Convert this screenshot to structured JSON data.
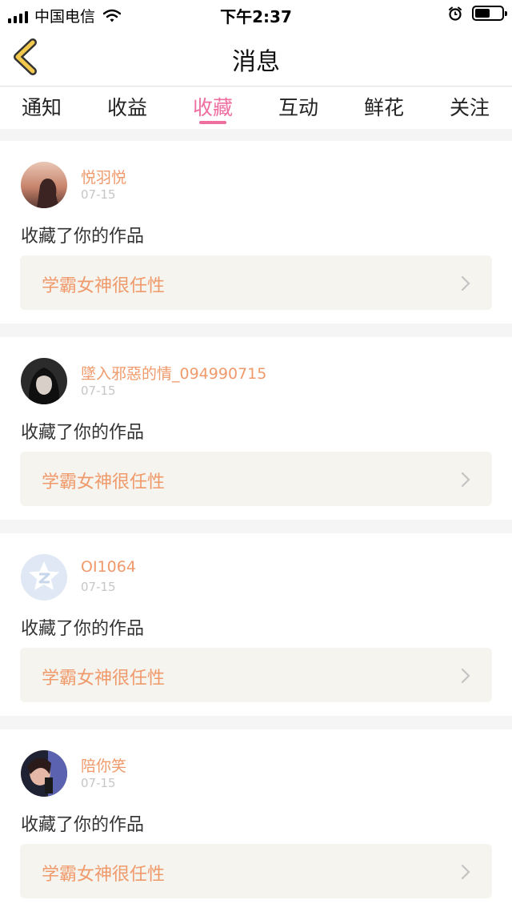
{
  "status_bar": {
    "carrier": "中国电信",
    "time": "下午2:37",
    "battery_level": 0.55,
    "icons": [
      "signal-icon",
      "wifi-icon",
      "alarm-icon",
      "battery-icon"
    ]
  },
  "nav": {
    "title": "消息",
    "back_icon": "chevron-left-icon"
  },
  "tabs": [
    {
      "label": "通知",
      "active": false
    },
    {
      "label": "收益",
      "active": false
    },
    {
      "label": "收藏",
      "active": true
    },
    {
      "label": "互动",
      "active": false
    },
    {
      "label": "鲜花",
      "active": false
    },
    {
      "label": "关注",
      "active": false
    }
  ],
  "messages": [
    {
      "user": "悦羽悦",
      "date": "07-15",
      "action": "收藏了你的作品",
      "work_title": "学霸女神很任性",
      "avatar": "photo-avatar"
    },
    {
      "user": "墜入邪惡的情_094990715",
      "date": "07-15",
      "action": "收藏了你的作品",
      "work_title": "学霸女神很任性",
      "avatar": "photo-avatar"
    },
    {
      "user": "OI1064",
      "date": "07-15",
      "action": "收藏了你的作品",
      "work_title": "学霸女神很任性",
      "avatar": "default-avatar"
    },
    {
      "user": "陪你笑",
      "date": "07-15",
      "action": "收藏了你的作品",
      "work_title": "学霸女神很任性",
      "avatar": "photo-avatar"
    }
  ],
  "colors": {
    "accent_pink": "#ee6fa0",
    "name_orange": "#f09a6c",
    "back_yellow": "#f2c94c",
    "card_bg": "#f5f4ee"
  }
}
